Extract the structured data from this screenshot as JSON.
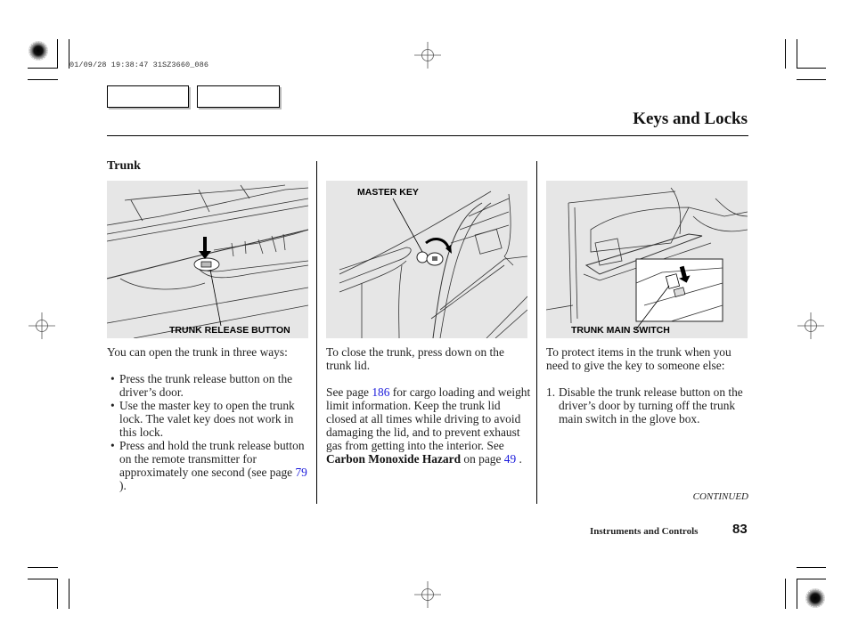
{
  "print_stamp": "01/09/28 19:38:47 31SZ3660_086",
  "nav_buttons": [
    {
      "label": ""
    },
    {
      "label": ""
    }
  ],
  "header": {
    "title": "Keys and Locks"
  },
  "section": {
    "heading": "Trunk"
  },
  "figures": [
    {
      "label": "TRUNK RELEASE BUTTON",
      "icon": "trunk-release-button-illustration"
    },
    {
      "label": "MASTER KEY",
      "icon": "master-key-trunk-lock-illustration"
    },
    {
      "label": "TRUNK MAIN SWITCH",
      "icon": "glove-box-trunk-main-switch-illustration"
    }
  ],
  "column1": {
    "intro": "You can open the trunk in three ways:",
    "bullets": [
      {
        "text": "Press the trunk release button on the driver’s door."
      },
      {
        "text": "Use the master key to open the trunk lock. The valet key does not work in this lock."
      },
      {
        "text_before": "Press and hold the trunk release button on the remote transmitter for approximately one second (see page ",
        "link": "79",
        "text_after": " )."
      }
    ]
  },
  "column2": {
    "para1": "To close the trunk, press down on the trunk lid.",
    "para2_before": "See page ",
    "para2_link": "186",
    "para2_mid": " for cargo loading and weight limit information. Keep the trunk lid closed at all times while driving to avoid damaging the lid, and to prevent exhaust gas from getting into the interior. See ",
    "para2_bold": "Carbon Monoxide Hazard",
    "para2_after": " on page ",
    "para2_link2": "49",
    "para2_end": " ."
  },
  "column3": {
    "intro": "To protect items in the trunk when you need to give the key to someone else:",
    "steps": [
      {
        "num": "1.",
        "text": "Disable the trunk release button on the driver’s door by turning off the trunk main switch in the glove box."
      }
    ]
  },
  "footer": {
    "continued": "CONTINUED",
    "section_name": "Instruments and Controls",
    "page_number": "83"
  },
  "colors": {
    "link": "#1a1adb",
    "figure_bg": "#e6e6e6",
    "text": "#222222"
  }
}
